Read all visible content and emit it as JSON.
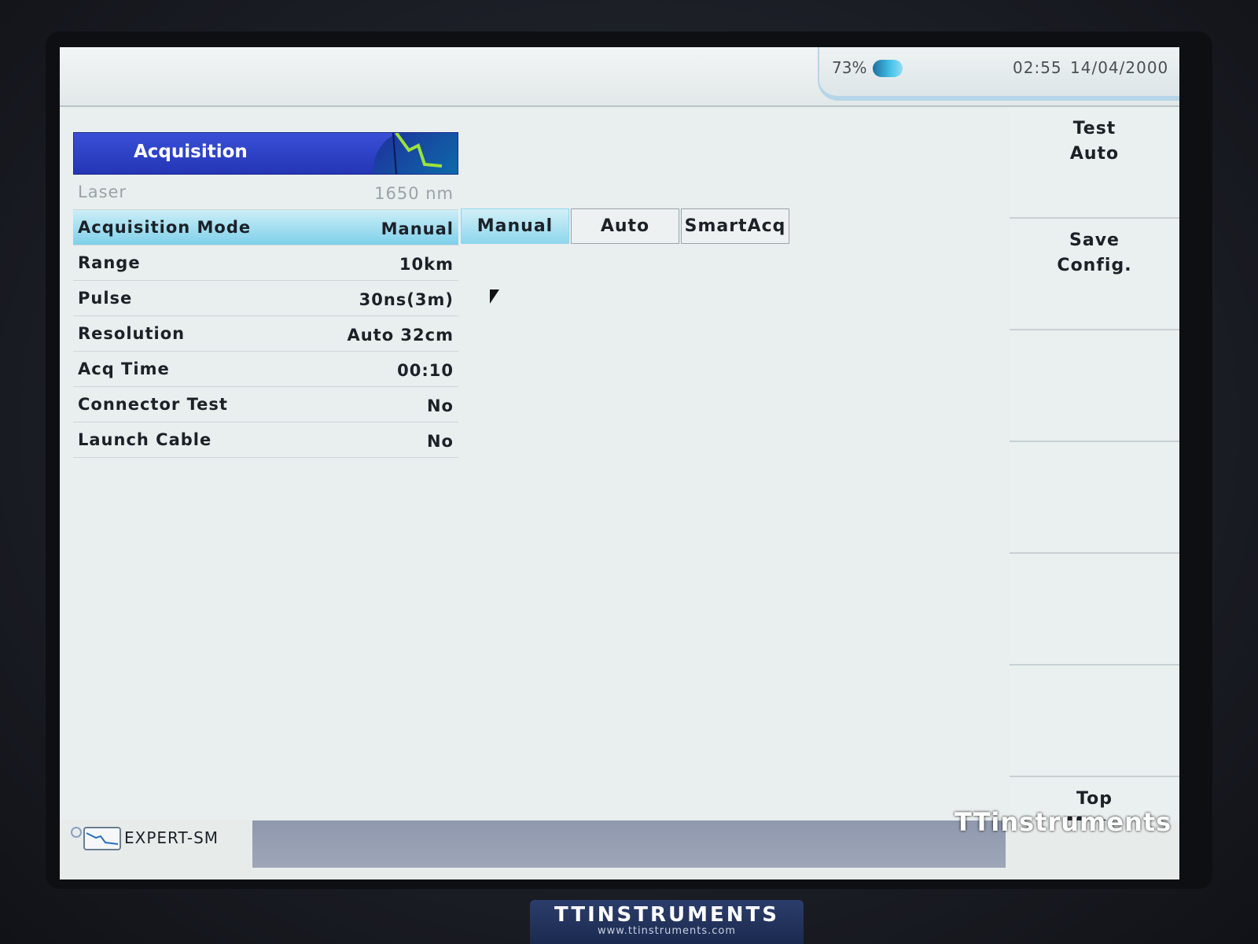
{
  "status_bar": {
    "battery_percent": "73%",
    "time": "02:55",
    "date": "14/04/2000"
  },
  "panel": {
    "title": "Acquisition",
    "rows": [
      {
        "label": "Laser",
        "value": "1650 nm",
        "disabled": true
      },
      {
        "label": "Acquisition Mode",
        "value": "Manual",
        "selected": true
      },
      {
        "label": "Range",
        "value": "10km"
      },
      {
        "label": "Pulse",
        "value": "30ns(3m)"
      },
      {
        "label": "Resolution",
        "value": "Auto 32cm"
      },
      {
        "label": "Acq Time",
        "value": "00:10"
      },
      {
        "label": "Connector Test",
        "value": "No"
      },
      {
        "label": "Launch Cable",
        "value": "No"
      }
    ]
  },
  "mode_options": [
    "Manual",
    "Auto",
    "SmartAcq"
  ],
  "mode_options_selected": "Manual",
  "side_menu": {
    "test_auto": [
      "Test",
      "Auto"
    ],
    "save_config": [
      "Save",
      "Config."
    ],
    "top_menu": [
      "Top",
      "Menu"
    ]
  },
  "bottom": {
    "mode_label": "EXPERT-SM"
  },
  "watermark": "TTinstruments",
  "brand": {
    "name": "TTINSTRUMENTS",
    "url": "www.ttinstruments.com"
  },
  "colors": {
    "header_blue": "#2a3cc8",
    "selection_cyan": "#8fd6ec",
    "screen_bg": "#e9eeee"
  }
}
